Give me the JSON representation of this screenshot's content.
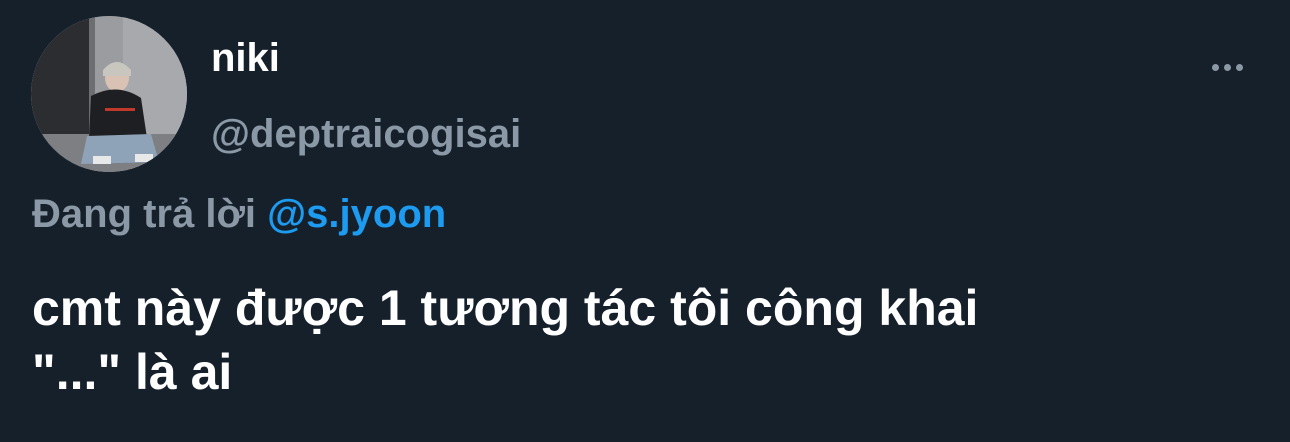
{
  "author": {
    "display_name": "niki",
    "handle": "@deptraicogisai"
  },
  "icons": {
    "more": "more-horizontal-icon"
  },
  "reply": {
    "prefix": "Đang trả lời",
    "mention": "@s.jyoon"
  },
  "tweet": {
    "text_line1": "cmt này được 1 tương tác tôi công khai",
    "text_line2": "\"...\" là ai"
  },
  "colors": {
    "background": "#15202b",
    "primary_text": "#ffffff",
    "secondary_text": "#8b98a5",
    "accent": "#1d9bf0"
  }
}
